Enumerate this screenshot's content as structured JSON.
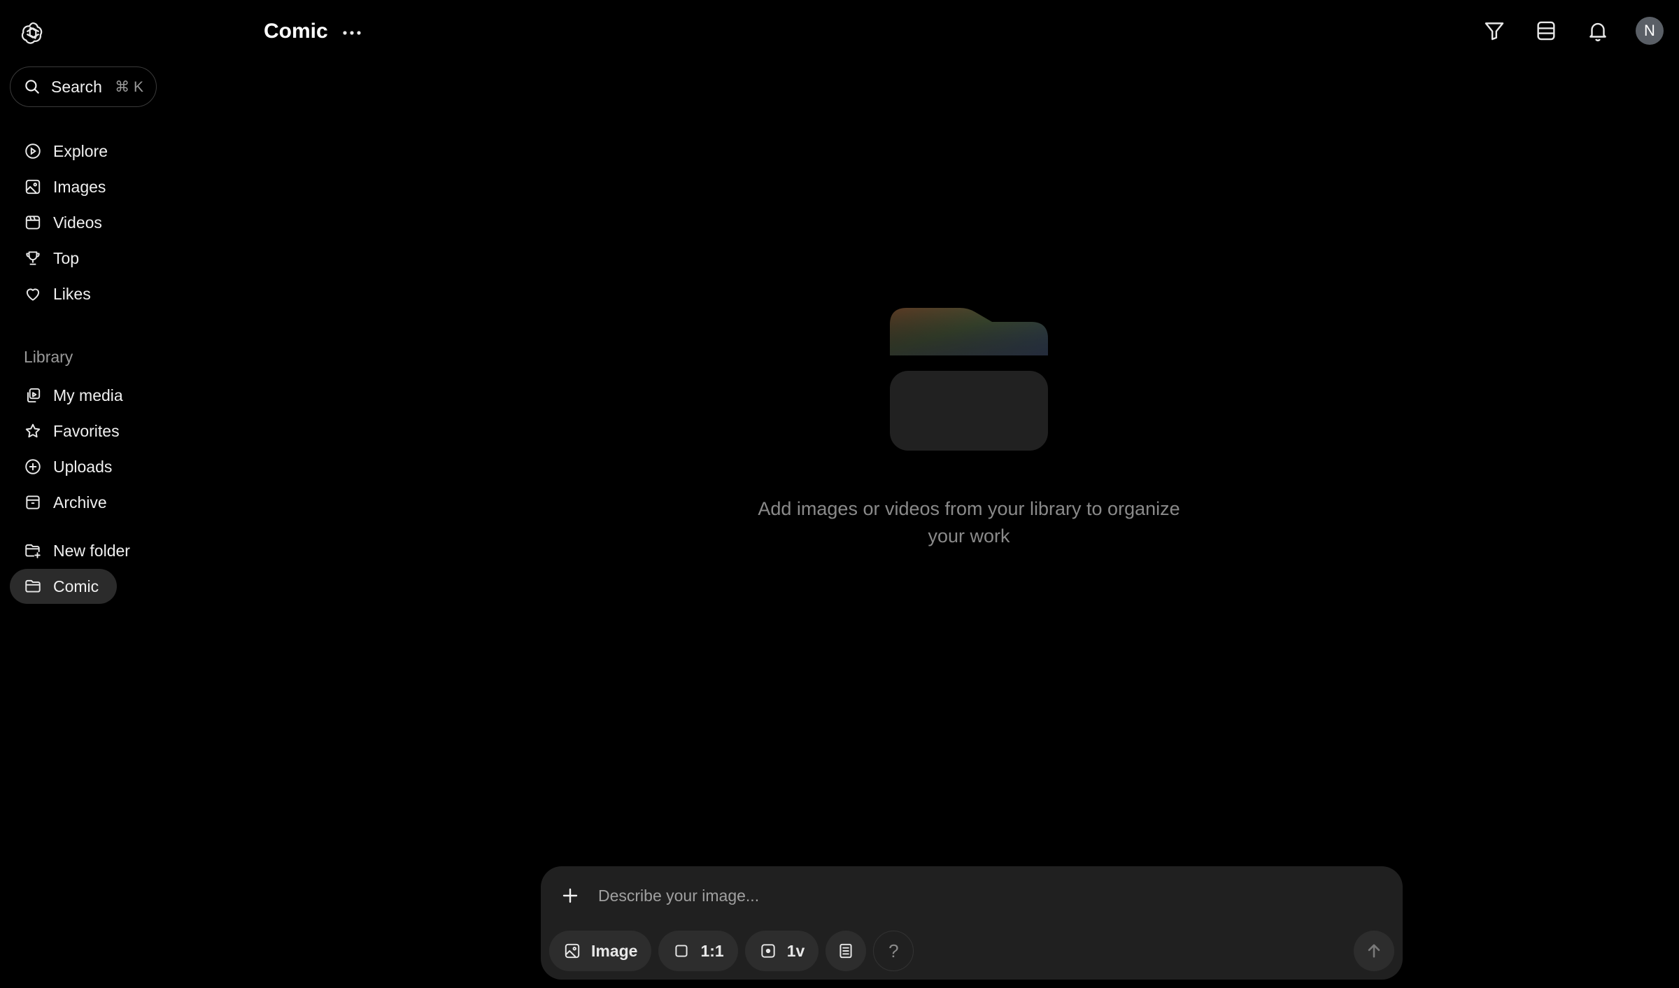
{
  "header": {
    "title": "Comic"
  },
  "search": {
    "label": "Search",
    "shortcut": "⌘ K"
  },
  "nav": {
    "items": [
      {
        "label": "Explore",
        "icon": "compass-icon"
      },
      {
        "label": "Images",
        "icon": "image-icon"
      },
      {
        "label": "Videos",
        "icon": "video-icon"
      },
      {
        "label": "Top",
        "icon": "trophy-icon"
      },
      {
        "label": "Likes",
        "icon": "heart-icon"
      }
    ]
  },
  "library": {
    "section_label": "Library",
    "items": [
      {
        "label": "My media",
        "icon": "media-icon"
      },
      {
        "label": "Favorites",
        "icon": "star-icon"
      },
      {
        "label": "Uploads",
        "icon": "upload-icon"
      },
      {
        "label": "Archive",
        "icon": "archive-icon"
      }
    ]
  },
  "folders": {
    "new_folder_label": "New folder",
    "items": [
      {
        "label": "Comic",
        "active": true
      }
    ]
  },
  "user": {
    "avatar_initial": "N"
  },
  "empty_state": {
    "message": "Add images or videos from your library to organize your work"
  },
  "composer": {
    "placeholder": "Describe your image...",
    "mode_label": "Image",
    "aspect_label": "1:1",
    "variations_label": "1v",
    "help_label": "?"
  },
  "colors": {
    "background": "#000000",
    "surface": "#202020",
    "chip": "#2d2d2d",
    "muted_text": "#8a8a8a"
  }
}
